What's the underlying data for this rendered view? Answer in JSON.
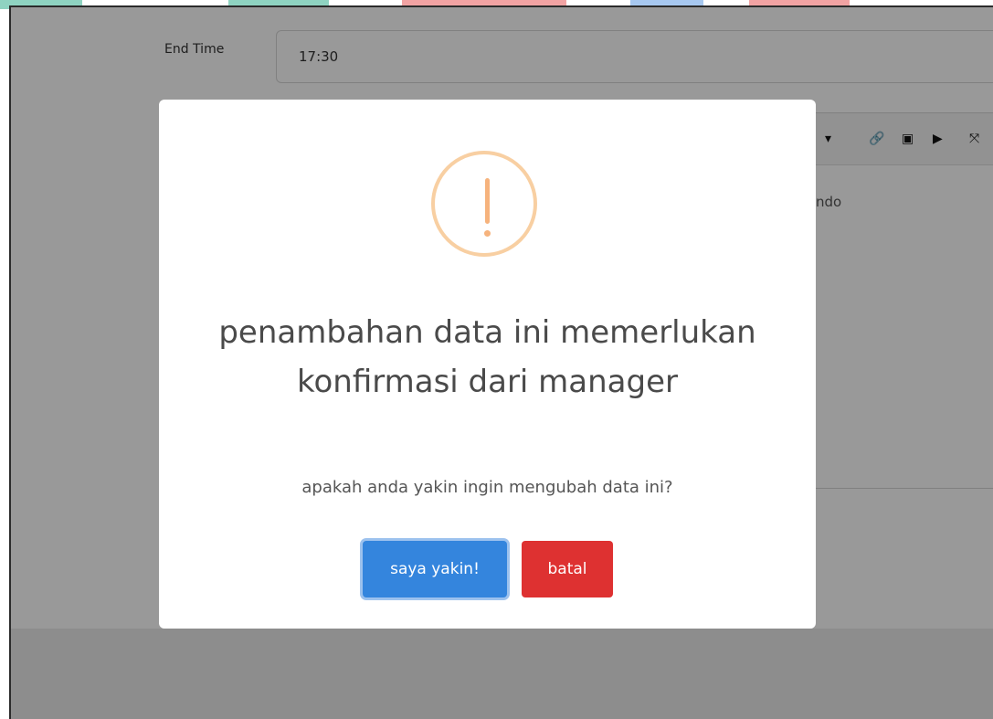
{
  "form": {
    "end_time_label": "End Time",
    "end_time_value": "17:30",
    "editor_partial_text": "ndo"
  },
  "dialog": {
    "icon": "warning-exclamation",
    "title": "penambahan data ini memerlukan konfirmasi dari manager",
    "message": "apakah anda yakin ingin mengubah data ini?",
    "confirm_label": "saya yakin!",
    "cancel_label": "batal"
  },
  "colors": {
    "confirm": "#3485dd",
    "cancel": "#de3131",
    "warning": "#f8cfa2"
  }
}
